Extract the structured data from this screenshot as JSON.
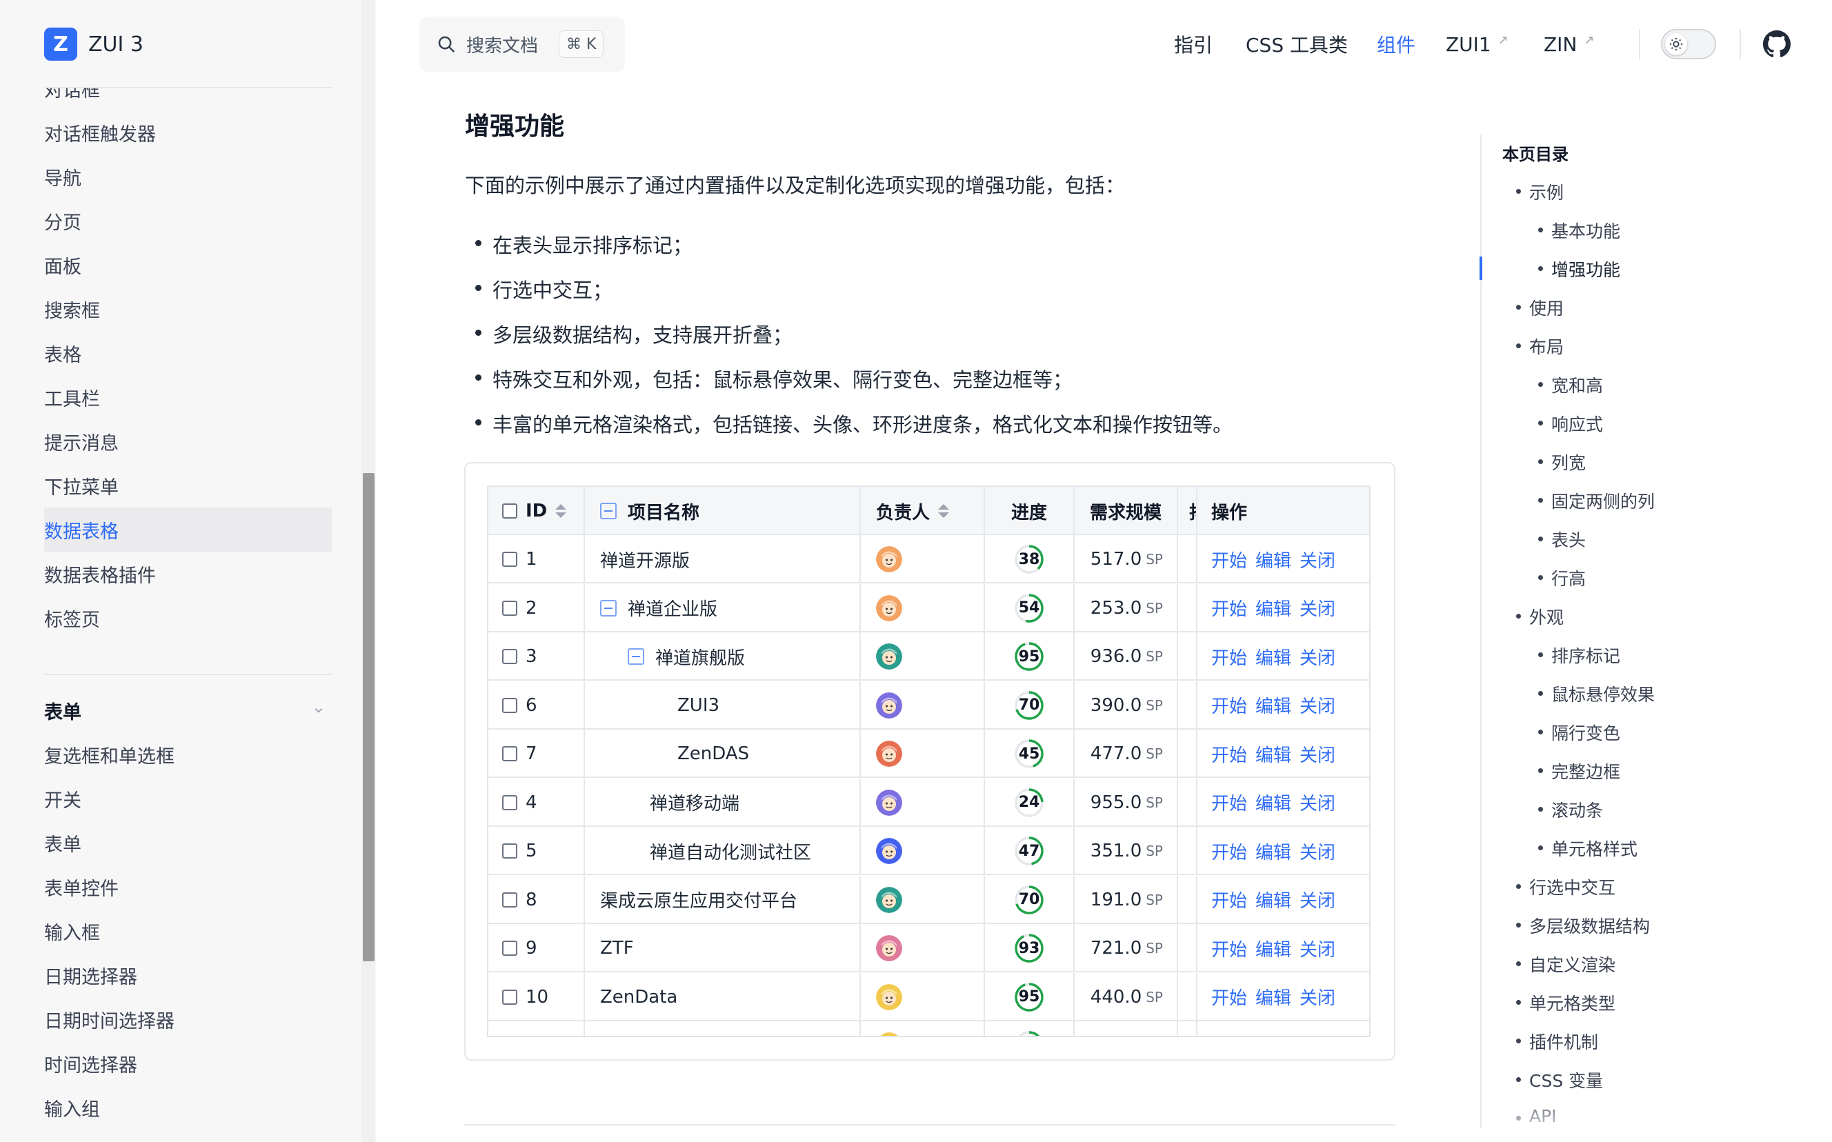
{
  "brand": {
    "logo_letter": "Z",
    "name": "ZUI 3"
  },
  "sidebar": {
    "partial_item": "对话框",
    "items": [
      {
        "label": "对话框触发器",
        "active": false
      },
      {
        "label": "导航",
        "active": false
      },
      {
        "label": "分页",
        "active": false
      },
      {
        "label": "面板",
        "active": false
      },
      {
        "label": "搜索框",
        "active": false
      },
      {
        "label": "表格",
        "active": false
      },
      {
        "label": "工具栏",
        "active": false
      },
      {
        "label": "提示消息",
        "active": false
      },
      {
        "label": "下拉菜单",
        "active": false
      },
      {
        "label": "数据表格",
        "active": true
      },
      {
        "label": "数据表格插件",
        "active": false
      },
      {
        "label": "标签页",
        "active": false
      }
    ],
    "section": {
      "label": "表单"
    },
    "section_items": [
      {
        "label": "复选框和单选框"
      },
      {
        "label": "开关"
      },
      {
        "label": "表单"
      },
      {
        "label": "表单控件"
      },
      {
        "label": "输入框"
      },
      {
        "label": "日期选择器"
      },
      {
        "label": "日期时间选择器"
      },
      {
        "label": "时间选择器"
      },
      {
        "label": "输入组"
      }
    ]
  },
  "search": {
    "placeholder": "搜索文档",
    "shortcut": "⌘ K"
  },
  "topnav": {
    "links": [
      {
        "label": "指引",
        "active": false,
        "external": false
      },
      {
        "label": "CSS 工具类",
        "active": false,
        "external": false
      },
      {
        "label": "组件",
        "active": true,
        "external": false
      },
      {
        "label": "ZUI1",
        "active": false,
        "external": true
      },
      {
        "label": "ZIN",
        "active": false,
        "external": true
      }
    ],
    "theme": "light",
    "github_icon": "github-icon"
  },
  "content": {
    "title": "增强功能",
    "intro": "下面的示例中展示了通过内置插件以及定制化选项实现的增强功能，包括：",
    "bullets": [
      "在表头显示排序标记；",
      "行选中交互；",
      "多层级数据结构，支持展开折叠；",
      "特殊交互和外观，包括：鼠标悬停效果、隔行变色、完整边框等；",
      "丰富的单元格渲染格式，包括链接、头像、环形进度条，格式化文本和操作按钮等。"
    ]
  },
  "table": {
    "columns": {
      "id": "ID",
      "name": "项目名称",
      "owner": "负责人",
      "progress": "进度",
      "scale": "需求规模",
      "hidden": "抖",
      "actions": "操作"
    },
    "unit": "SP",
    "action_labels": [
      "开始",
      "编辑",
      "关闭"
    ],
    "rows": [
      {
        "id": "1",
        "name": "禅道开源版",
        "level": 0,
        "toggle": false,
        "avatar": "#f4a261",
        "progress": 38,
        "scale": "517.0"
      },
      {
        "id": "2",
        "name": "禅道企业版",
        "level": 0,
        "toggle": true,
        "avatar": "#f4a261",
        "progress": 54,
        "scale": "253.0"
      },
      {
        "id": "3",
        "name": "禅道旗舰版",
        "level": 1,
        "toggle": true,
        "avatar": "#2a9d8f",
        "progress": 95,
        "scale": "936.0"
      },
      {
        "id": "6",
        "name": "ZUI3",
        "level": 2,
        "toggle": false,
        "avatar": "#7c6fe0",
        "progress": 70,
        "scale": "390.0"
      },
      {
        "id": "7",
        "name": "ZenDAS",
        "level": 2,
        "toggle": false,
        "avatar": "#e76f51",
        "progress": 45,
        "scale": "477.0"
      },
      {
        "id": "4",
        "name": "禅道移动端",
        "level": 1.5,
        "toggle": false,
        "avatar": "#7c6fe0",
        "progress": 24,
        "scale": "955.0"
      },
      {
        "id": "5",
        "name": "禅道自动化测试社区",
        "level": 1.5,
        "toggle": false,
        "avatar": "#4361ee",
        "progress": 47,
        "scale": "351.0"
      },
      {
        "id": "8",
        "name": "渠成云原生应用交付平台",
        "level": 0,
        "toggle": false,
        "avatar": "#2a9d8f",
        "progress": 70,
        "scale": "191.0"
      },
      {
        "id": "9",
        "name": "ZTF",
        "level": 0,
        "toggle": false,
        "avatar": "#e07a9a",
        "progress": 93,
        "scale": "721.0"
      },
      {
        "id": "10",
        "name": "ZenData",
        "level": 0,
        "toggle": false,
        "avatar": "#f2c94c",
        "progress": 95,
        "scale": "440.0"
      }
    ]
  },
  "toc": {
    "title": "本页目录",
    "items": [
      {
        "label": "示例",
        "level": 1
      },
      {
        "label": "基本功能",
        "level": 2
      },
      {
        "label": "增强功能",
        "level": 2,
        "active": true
      },
      {
        "label": "使用",
        "level": 1
      },
      {
        "label": "布局",
        "level": 1
      },
      {
        "label": "宽和高",
        "level": 2
      },
      {
        "label": "响应式",
        "level": 2
      },
      {
        "label": "列宽",
        "level": 2
      },
      {
        "label": "固定两侧的列",
        "level": 2
      },
      {
        "label": "表头",
        "level": 2
      },
      {
        "label": "行高",
        "level": 2
      },
      {
        "label": "外观",
        "level": 1
      },
      {
        "label": "排序标记",
        "level": 2
      },
      {
        "label": "鼠标悬停效果",
        "level": 2
      },
      {
        "label": "隔行变色",
        "level": 2
      },
      {
        "label": "完整边框",
        "level": 2
      },
      {
        "label": "滚动条",
        "level": 2
      },
      {
        "label": "单元格样式",
        "level": 2
      },
      {
        "label": "行选中交互",
        "level": 1
      },
      {
        "label": "多层级数据结构",
        "level": 1
      },
      {
        "label": "自定义渲染",
        "level": 1
      },
      {
        "label": "单元格类型",
        "level": 1
      },
      {
        "label": "插件机制",
        "level": 1
      },
      {
        "label": "CSS 变量",
        "level": 1
      },
      {
        "label": "API",
        "level": 1
      }
    ]
  },
  "colors": {
    "accent": "#2f6df6",
    "progress_ring": "#22a34a"
  }
}
